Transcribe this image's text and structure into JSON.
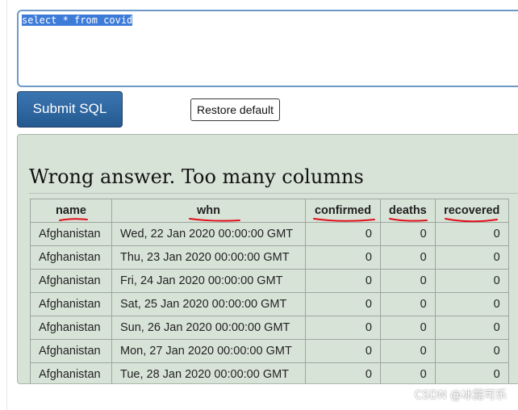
{
  "editor": {
    "sql": "select * from covid"
  },
  "buttons": {
    "submit_label": "Submit SQL",
    "restore_label": "Restore default"
  },
  "result": {
    "message": "Wrong answer. Too many columns",
    "columns": [
      "name",
      "whn",
      "confirmed",
      "deaths",
      "recovered"
    ],
    "rows": [
      [
        "Afghanistan",
        "Wed, 22 Jan 2020 00:00:00 GMT",
        "0",
        "0",
        "0"
      ],
      [
        "Afghanistan",
        "Thu, 23 Jan 2020 00:00:00 GMT",
        "0",
        "0",
        "0"
      ],
      [
        "Afghanistan",
        "Fri, 24 Jan 2020 00:00:00 GMT",
        "0",
        "0",
        "0"
      ],
      [
        "Afghanistan",
        "Sat, 25 Jan 2020 00:00:00 GMT",
        "0",
        "0",
        "0"
      ],
      [
        "Afghanistan",
        "Sun, 26 Jan 2020 00:00:00 GMT",
        "0",
        "0",
        "0"
      ],
      [
        "Afghanistan",
        "Mon, 27 Jan 2020 00:00:00 GMT",
        "0",
        "0",
        "0"
      ],
      [
        "Afghanistan",
        "Tue, 28 Jan 2020 00:00:00 GMT",
        "0",
        "0",
        "0"
      ]
    ]
  },
  "annotation": {
    "ink_color": "#e0101a"
  },
  "watermark": "CSDN @冰露可乐",
  "colors": {
    "submit_bg": "#2e6aa6",
    "panel_bg": "#d8e3d8",
    "selection": "#3d7bd9",
    "editor_border": "#6f9ac8"
  }
}
